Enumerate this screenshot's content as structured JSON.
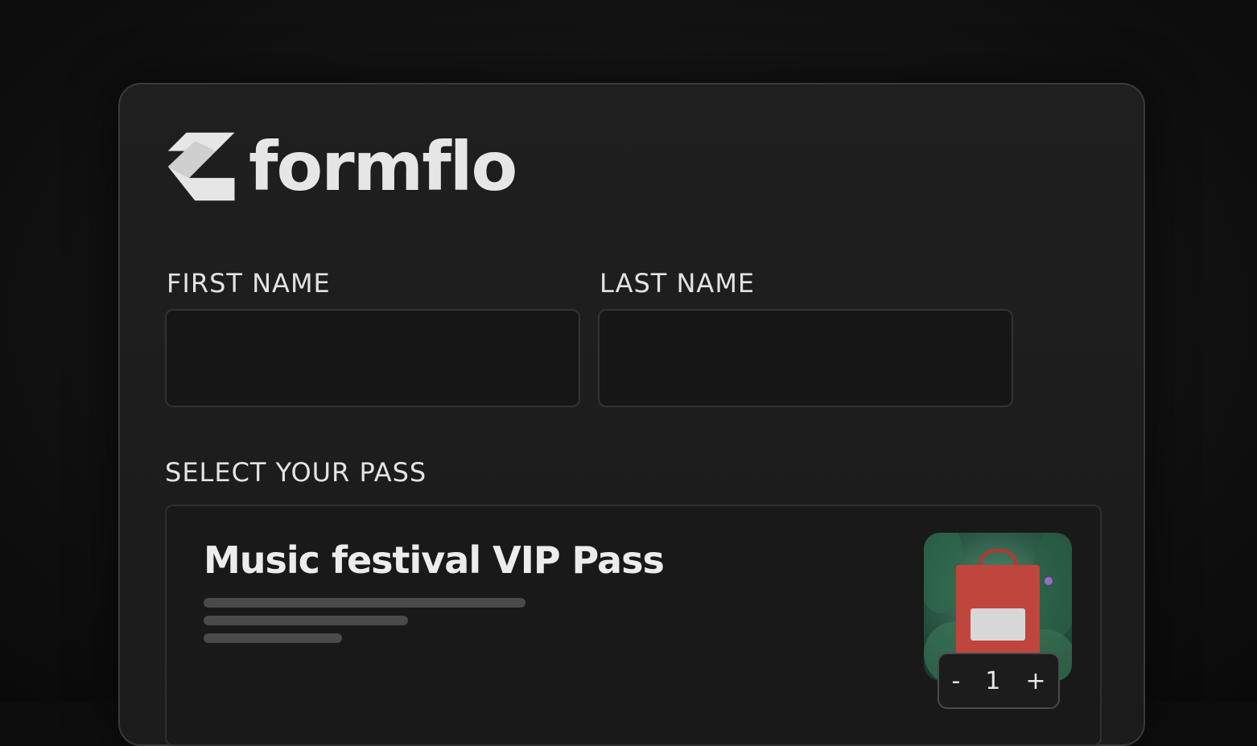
{
  "brand": {
    "name": "formflo",
    "logo_icon": "formflo-logo-icon"
  },
  "form": {
    "first_name": {
      "label": "FIRST NAME",
      "value": "",
      "placeholder": ""
    },
    "last_name": {
      "label": "LAST NAME",
      "value": "",
      "placeholder": ""
    },
    "pass_section_label": "SELECT YOUR PASS"
  },
  "pass": {
    "title": "Music festival VIP Pass",
    "image_icon": "shopping-bag-icon",
    "quantity": {
      "minus": "-",
      "value": "1",
      "plus": "+"
    }
  },
  "colors": {
    "background": "#121212",
    "card": "#1e1e1e",
    "text": "#e6e6e6",
    "bag": "#c0392b",
    "foliage": "#2d5b47"
  }
}
